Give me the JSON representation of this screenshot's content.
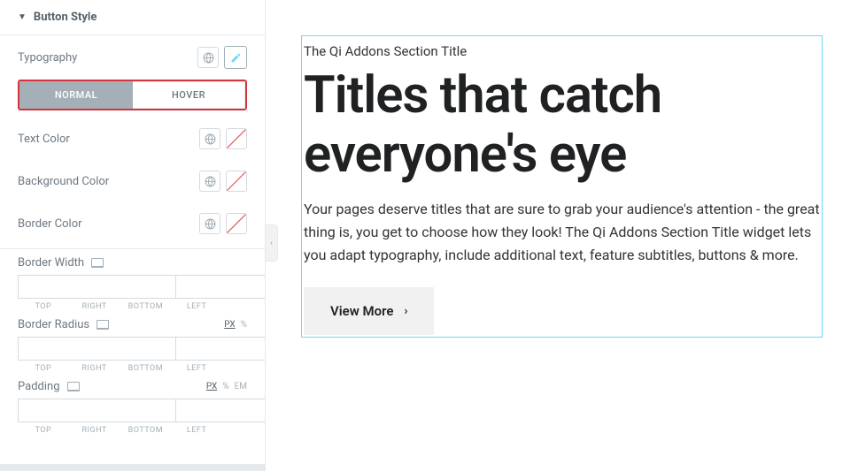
{
  "panel": {
    "section_title": "Button Style",
    "typography_label": "Typography",
    "tabs": {
      "normal": "NORMAL",
      "hover": "HOVER"
    },
    "text_color_label": "Text Color",
    "bg_color_label": "Background Color",
    "border_color_label": "Border Color",
    "border_width_label": "Border Width",
    "border_radius_label": "Border Radius",
    "padding_label": "Padding",
    "units": {
      "px": "PX",
      "pct": "%",
      "em": "EM"
    },
    "sides": {
      "top": "TOP",
      "right": "RIGHT",
      "bottom": "BOTTOM",
      "left": "LEFT"
    }
  },
  "preview": {
    "subtitle": "The Qi Addons Section Title",
    "title": "Titles that catch everyone's eye",
    "description": "Your pages deserve titles that are sure to grab your audience's attention - the great thing is, you get to choose how they look! The Qi Addons Section Title widget lets you adapt typography, include additional text, feature subtitles, buttons & more.",
    "button_label": "View More"
  }
}
